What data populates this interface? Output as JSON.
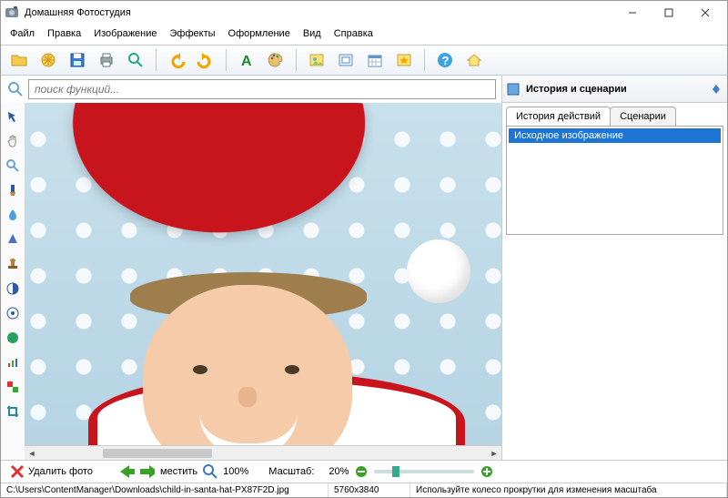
{
  "app": {
    "title": "Домашняя Фотостудия"
  },
  "menu": [
    "Файл",
    "Правка",
    "Изображение",
    "Эффекты",
    "Оформление",
    "Вид",
    "Справка"
  ],
  "toolbar_icons": [
    "open-folder-icon",
    "enhance-icon",
    "save-icon",
    "print-icon",
    "zoom-tool-icon",
    "undo-icon",
    "redo-icon",
    "text-tool-icon",
    "palette-icon",
    "photo-icon",
    "frame-icon",
    "calendar-icon",
    "effects-icon",
    "help-icon",
    "home-icon"
  ],
  "search": {
    "placeholder": "поиск функций..."
  },
  "left_tools": [
    "pointer-icon",
    "hand-icon",
    "magnifier-icon",
    "brush-icon",
    "drop-icon",
    "blur-icon",
    "stamp-icon",
    "contrast-icon",
    "balance-icon",
    "swatch-icon",
    "levels-icon",
    "colorfill-icon",
    "crop-icon"
  ],
  "right_panel": {
    "title": "История и сценарии",
    "tabs": [
      "История действий",
      "Сценарии"
    ],
    "active_tab": 0,
    "history": [
      "Исходное изображение"
    ]
  },
  "bottom": {
    "delete_label": "Удалить фото",
    "fit_label": "местить",
    "fit100": "100%",
    "scale_label": "Масштаб:",
    "scale_value": "20%"
  },
  "status": {
    "path": "C:\\Users\\ContentManager\\Downloads\\child-in-santa-hat-PX87F2D.jpg",
    "dims": "5760x3840",
    "hint": "Используйте колесо прокрутки для изменения масштаба"
  }
}
